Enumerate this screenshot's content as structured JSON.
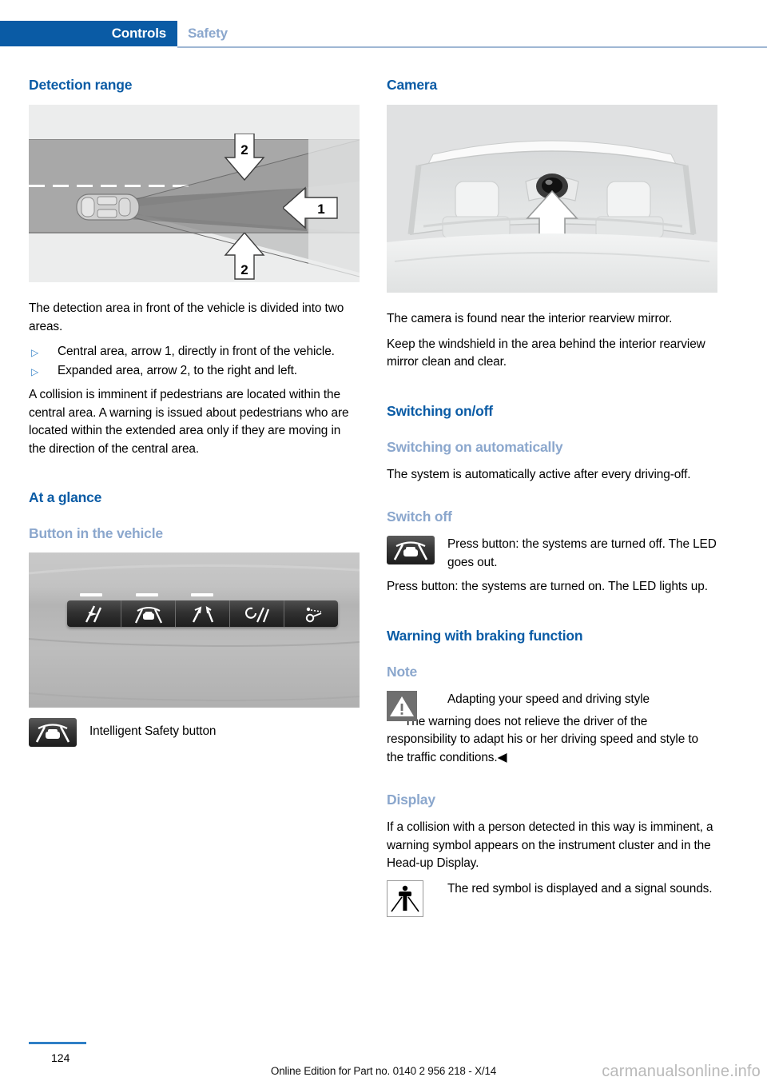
{
  "header": {
    "active_tab": "Controls",
    "inactive_tab": "Safety",
    "accent_color": "#0a5ba5",
    "muted_color": "#8ba7cd"
  },
  "left_column": {
    "detection_heading": "Detection range",
    "detection_figure": {
      "alt": "Top view of road showing vehicle detection beam areas",
      "arrow_labels": [
        "2",
        "1",
        "2"
      ]
    },
    "detection_intro": "The detection area in front of the vehicle is divided into two areas.",
    "bullets": [
      "Central area, arrow 1, directly in front of the vehicle.",
      "Expanded area, arrow 2, to the right and left."
    ],
    "detection_body": "A collision is imminent if pedestrians are located within the central area. A warning is issued about pedestrians who are located within the extended area only if they are moving in the direction of the central area.",
    "at_a_glance_heading": "At a glance",
    "button_heading": "Button in the vehicle",
    "button_figure": {
      "alt": "Vehicle trim panel with row of five control buttons"
    },
    "button_caption": "Intelligent Safety button"
  },
  "right_column": {
    "camera_heading": "Camera",
    "camera_figure": {
      "alt": "View of windshield interior with camera near rearview mirror"
    },
    "camera_body_1": "The camera is found near the interior rearview mirror.",
    "camera_body_2": "Keep the windshield in the area behind the interior rearview mirror clean and clear.",
    "switching_heading": "Switching on/off",
    "switch_auto_heading": "Switching on automatically",
    "switch_auto_body": "The system is automatically active after every driving-off.",
    "switch_off_heading": "Switch off",
    "switch_off_icon_text": "Press button: the systems are turned off. The LED goes out.",
    "switch_on_body": "Press button: the systems are turned on. The LED lights up.",
    "warning_heading": "Warning with braking function",
    "note_heading": "Note",
    "note_title": "Adapting your speed and driving style",
    "note_body": "The warning does not relieve the driver of the responsibility to adapt his or her driving speed and style to the traffic conditions.◀",
    "display_heading": "Display",
    "display_body": "If a collision with a person detected in this way is imminent, a warning symbol appears on the instrument cluster and in the Head-up Display.",
    "display_icon_text": "The red symbol is displayed and a signal sounds."
  },
  "footer": {
    "page_number": "124",
    "edition": "Online Edition for Part no. 0140 2 956 218 - X/14",
    "watermark": "carmanualsonline.info"
  }
}
